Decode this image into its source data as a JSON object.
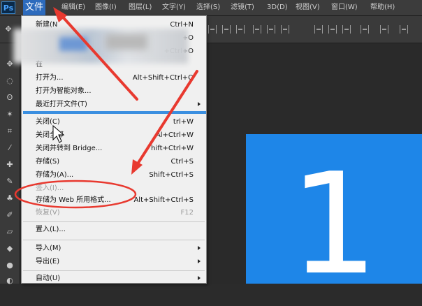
{
  "app": {
    "logo": "Ps"
  },
  "menubar": {
    "items": [
      {
        "id": "file",
        "label": "文件"
      },
      {
        "id": "edit",
        "label": "编辑(E)"
      },
      {
        "id": "image",
        "label": "图像(I)"
      },
      {
        "id": "layer",
        "label": "图层(L)"
      },
      {
        "id": "type",
        "label": "文字(Y)"
      },
      {
        "id": "select",
        "label": "选择(S)"
      },
      {
        "id": "filter",
        "label": "滤镜(T)"
      },
      {
        "id": "3d",
        "label": "3D(D)"
      },
      {
        "id": "view",
        "label": "视图(V)"
      },
      {
        "id": "window",
        "label": "窗口(W)"
      },
      {
        "id": "help",
        "label": "帮助(H)"
      }
    ]
  },
  "file_menu": {
    "items": [
      {
        "label": "新建(N",
        "shortcut": "Ctrl+N"
      },
      {
        "label": "",
        "shortcut": "+O"
      },
      {
        "label": "",
        "shortcut": "+Ctrl+O"
      },
      {
        "label": "在",
        "shortcut": ""
      },
      {
        "label": "打开为...",
        "shortcut": "Alt+Shift+Ctrl+O"
      },
      {
        "label": "打开为智能对象...",
        "shortcut": ""
      },
      {
        "label": "最近打开文件(T)",
        "shortcut": ""
      },
      {
        "label": "关闭(C)",
        "shortcut": "trl+W"
      },
      {
        "label": "关闭全部",
        "shortcut": "Al+Ctrl+W"
      },
      {
        "label": "关闭并转到 Bridge...",
        "shortcut": "hift+Ctrl+W"
      },
      {
        "label": "存储(S)",
        "shortcut": "Ctrl+S"
      },
      {
        "label": "存储为(A)...",
        "shortcut": "Shift+Ctrl+S"
      },
      {
        "label": "签入(I)...",
        "shortcut": ""
      },
      {
        "label": "存储为 Web 所用格式...",
        "shortcut": "Alt+Shift+Ctrl+S"
      },
      {
        "label": "恢复(V)",
        "shortcut": "F12"
      },
      {
        "label": "置入(L)...",
        "shortcut": ""
      },
      {
        "label": "导入(M)",
        "shortcut": ""
      },
      {
        "label": "导出(E)",
        "shortcut": ""
      },
      {
        "label": "自动(U)",
        "shortcut": ""
      }
    ]
  },
  "canvas": {
    "number": "1",
    "color": "#1e86e8"
  },
  "colors": {
    "accent": "#2d6bbd",
    "annotation": "#e8392f"
  }
}
